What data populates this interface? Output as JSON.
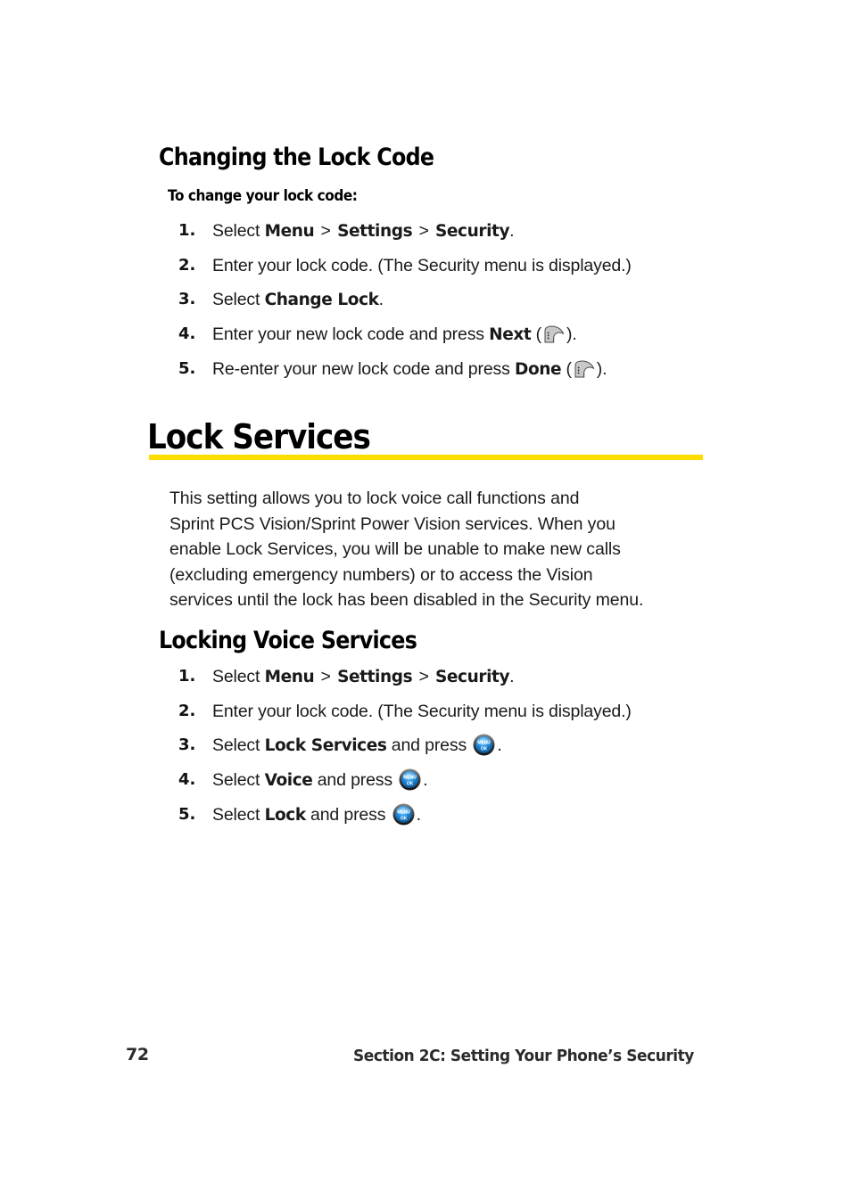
{
  "page": {
    "number": "72",
    "section_footer": "Section 2C: Setting Your Phone’s Security"
  },
  "section_change_lock": {
    "heading": "Changing the Lock Code",
    "leadin": "To change your lock code:",
    "steps": [
      {
        "num": "1.",
        "parts": [
          {
            "t": "Select ",
            "b": false
          },
          {
            "t": "Menu",
            "b": true
          },
          {
            "t": " > ",
            "b": false,
            "sep": true
          },
          {
            "t": "Settings",
            "b": true
          },
          {
            "t": " > ",
            "b": false,
            "sep": true
          },
          {
            "t": "Security",
            "b": true
          },
          {
            "t": ".",
            "b": false
          }
        ]
      },
      {
        "num": "2.",
        "parts": [
          {
            "t": "Enter your lock code. (The Security menu is displayed.)",
            "b": false
          }
        ]
      },
      {
        "num": "3.",
        "parts": [
          {
            "t": "Select ",
            "b": false
          },
          {
            "t": "Change Lock",
            "b": true
          },
          {
            "t": ".",
            "b": false
          }
        ]
      },
      {
        "num": "4.",
        "parts": [
          {
            "t": "Enter your new lock code and press ",
            "b": false
          },
          {
            "t": "Next",
            "b": true
          },
          {
            "t": " (",
            "b": false
          },
          {
            "icon": "softkey-icon"
          },
          {
            "t": ").",
            "b": false
          }
        ]
      },
      {
        "num": "5.",
        "parts": [
          {
            "t": "Re-enter your new lock code and press ",
            "b": false
          },
          {
            "t": "Done",
            "b": true
          },
          {
            "t": " (",
            "b": false
          },
          {
            "icon": "softkey-icon"
          },
          {
            "t": ").",
            "b": false
          }
        ]
      }
    ]
  },
  "section_lock_services": {
    "heading": "Lock Services",
    "rule_color": "#fddd00",
    "paragraph_lines": [
      "This setting allows you to lock voice call functions and",
      "Sprint PCS Vision/Sprint Power Vision services. When you",
      "enable Lock Services, you will be unable to make new calls",
      "(excluding emergency numbers) or to access the Vision",
      "services until the lock has been disabled in the Security menu."
    ]
  },
  "section_locking_voice": {
    "heading": "Locking Voice Services",
    "steps": [
      {
        "num": "1.",
        "parts": [
          {
            "t": "Select ",
            "b": false
          },
          {
            "t": "Menu",
            "b": true
          },
          {
            "t": " > ",
            "b": false,
            "sep": true
          },
          {
            "t": "Settings",
            "b": true
          },
          {
            "t": " > ",
            "b": false,
            "sep": true
          },
          {
            "t": "Security",
            "b": true
          },
          {
            "t": ".",
            "b": false
          }
        ]
      },
      {
        "num": "2.",
        "parts": [
          {
            "t": "Enter your lock code. (The Security menu is displayed.)",
            "b": false
          }
        ]
      },
      {
        "num": "3.",
        "parts": [
          {
            "t": "Select ",
            "b": false
          },
          {
            "t": "Lock Services",
            "b": true
          },
          {
            "t": " and press ",
            "b": false
          },
          {
            "icon": "menu-ok-button-icon"
          },
          {
            "t": ".",
            "b": false
          }
        ]
      },
      {
        "num": "4.",
        "parts": [
          {
            "t": "Select ",
            "b": false
          },
          {
            "t": "Voice",
            "b": true
          },
          {
            "t": " and press ",
            "b": false
          },
          {
            "icon": "menu-ok-button-icon"
          },
          {
            "t": ".",
            "b": false
          }
        ]
      },
      {
        "num": "5.",
        "parts": [
          {
            "t": "Select ",
            "b": false
          },
          {
            "t": "Lock",
            "b": true
          },
          {
            "t": " and press ",
            "b": false
          },
          {
            "icon": "menu-ok-button-icon"
          },
          {
            "t": ".",
            "b": false
          }
        ]
      }
    ]
  },
  "icons": {
    "menu_ok": {
      "top_label": "MENU",
      "bottom_label": "OK",
      "body_color": "#1e8ce0",
      "ring_color": "#3a3a3a"
    },
    "softkey": {
      "fill_color": "#c9c9c9"
    }
  }
}
